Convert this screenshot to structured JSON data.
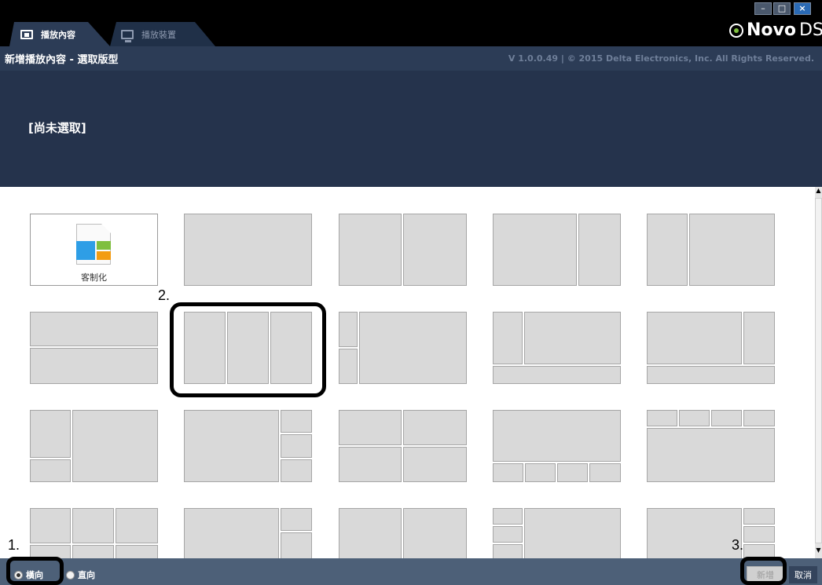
{
  "window": {
    "tabs": [
      {
        "label": "播放內容",
        "icon": "content-icon",
        "active": true
      },
      {
        "label": "播放裝置",
        "icon": "device-icon",
        "active": false
      }
    ],
    "controls": {
      "minimize": "–",
      "maximize": "□",
      "close": "×"
    },
    "logo": {
      "bold": "Novo",
      "light": "DS"
    }
  },
  "header": {
    "title": "新增播放內容 - 選取版型",
    "copyright": "V 1.0.0.49 | © 2015 Delta Electronics, Inc. All Rights Reserved."
  },
  "banner": {
    "selection": "[尚未選取]"
  },
  "layouts": {
    "custom_label": "客制化",
    "items": [
      "custom",
      "single",
      "two-columns",
      "wide-left-narrow-right",
      "narrow-left-wide-right",
      "two-rows",
      "three-columns",
      "left-stack-main",
      "main-left-stack-bottom",
      "main-right-stack-bottom",
      "left-stack-bottom-main",
      "main-right-stack3",
      "four-quadrants",
      "main-bottom4",
      "top4-main",
      "six-grid",
      "main-right-stack2",
      "two-columns-b",
      "left-stack3-main",
      "main-right-stack3-b"
    ]
  },
  "annotations": {
    "step1": "1.",
    "step2": "2.",
    "step3": "3."
  },
  "footer": {
    "orientation": [
      {
        "label": "橫向",
        "checked": true
      },
      {
        "label": "直向",
        "checked": false
      }
    ],
    "add_button": "新增",
    "cancel_button": "取消"
  },
  "colors": {
    "titlebar": "#000000",
    "header": "#2c3c56",
    "banner": "#25334c",
    "footer": "#4d6078",
    "pane": "#d9d9d9"
  }
}
